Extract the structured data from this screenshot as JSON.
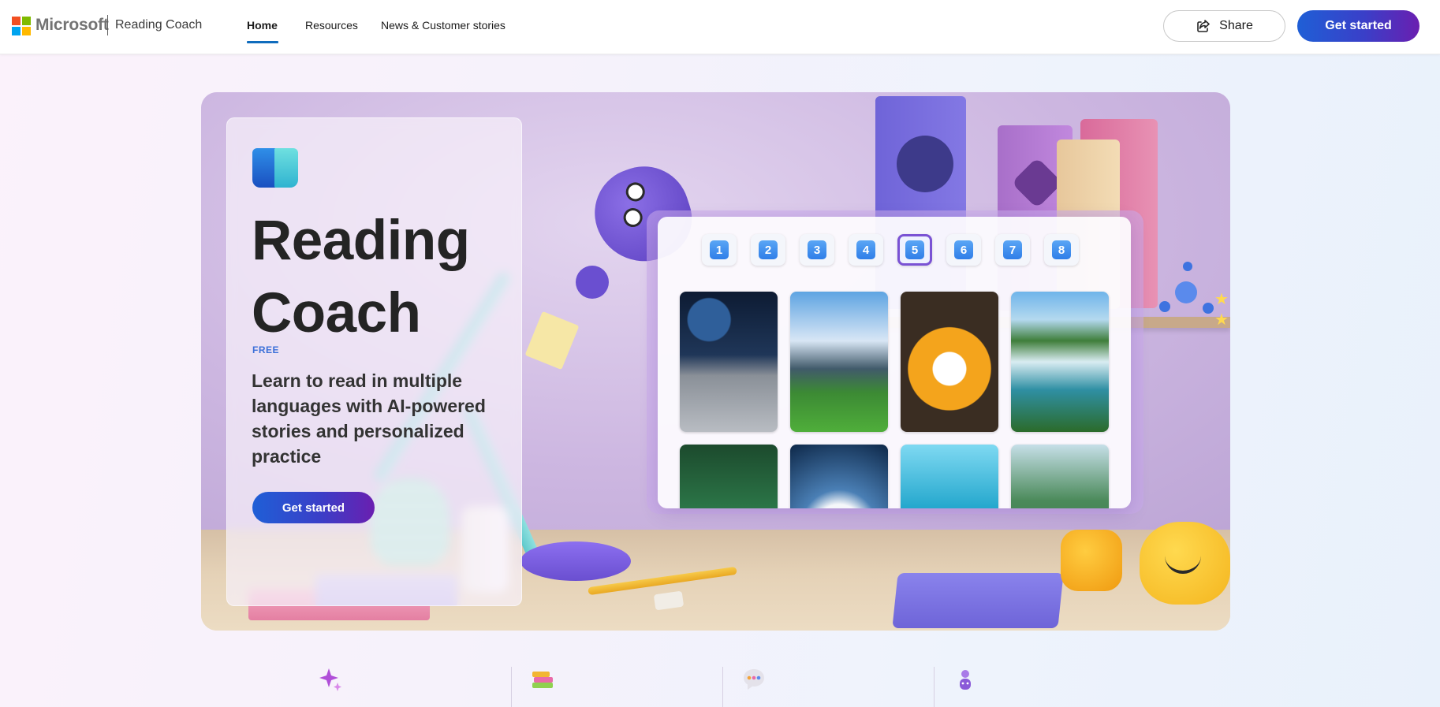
{
  "header": {
    "brand": "Microsoft",
    "product": "Reading Coach",
    "nav": [
      {
        "label": "Home"
      },
      {
        "label": "Resources"
      },
      {
        "label": "News & Customer stories"
      }
    ],
    "share_label": "Share",
    "get_started_label": "Get started"
  },
  "hero": {
    "title_line1": "Reading",
    "title_line2": "Coach",
    "tag": "FREE",
    "description": "Learn to read in multiple languages with AI-powered stories and personalized practice",
    "cta_label": "Get started",
    "levels": [
      "1",
      "2",
      "3",
      "4",
      "5",
      "6",
      "7",
      "8"
    ],
    "active_level": "5"
  },
  "colors": {
    "accent": "#0f6cbd",
    "cta_gradient_start": "#1f5fd6",
    "cta_gradient_end": "#6a1fb0",
    "free_tag": "#3a6fd8"
  },
  "icons": {
    "share": "share-icon",
    "app": "reading-coach-app-icon",
    "features": [
      "sparkle-icon",
      "books-stack-icon",
      "speech-bubble-icon",
      "avatar-icon"
    ]
  }
}
